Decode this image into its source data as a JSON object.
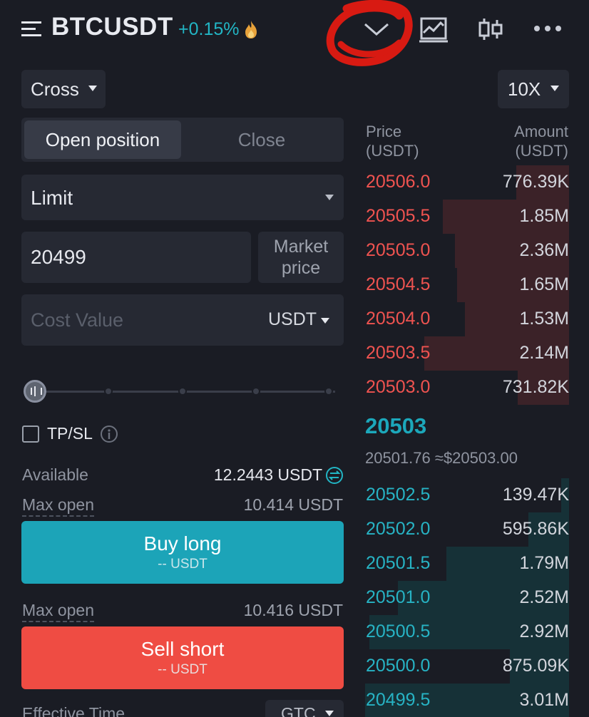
{
  "header": {
    "symbol": "BTCUSDT",
    "change": "+0.15%",
    "icons": [
      "menu-icon",
      "fire-icon",
      "chevron-down-icon",
      "chart-icon",
      "candlestick-icon",
      "more-icon"
    ]
  },
  "form": {
    "margin_mode": "Cross",
    "leverage": "10X",
    "tabs": {
      "open": "Open position",
      "close": "Close"
    },
    "order_type": "Limit",
    "price_value": "20499",
    "market_price_label": "Market price",
    "cost_placeholder": "Cost Value",
    "cost_unit": "USDT",
    "slider_percent": 0,
    "tpsl_label": "TP/SL",
    "available_label": "Available",
    "available_value": "12.2443 USDT",
    "buy": {
      "max_open_label": "Max open",
      "max_open_value": "10.414 USDT",
      "label": "Buy long",
      "sub": "-- USDT"
    },
    "sell": {
      "max_open_label": "Max open",
      "max_open_value": "10.416 USDT",
      "label": "Sell short",
      "sub": "-- USDT"
    },
    "effective_time_label": "Effective Time",
    "effective_time_value": "GTC"
  },
  "orderbook": {
    "price_header": "Price",
    "price_unit": "(USDT)",
    "amount_header": "Amount",
    "amount_unit": "(USDT)",
    "asks": [
      {
        "price": "20506.0",
        "amount": "776.39K",
        "depth": 0.26
      },
      {
        "price": "20505.5",
        "amount": "1.85M",
        "depth": 0.62
      },
      {
        "price": "20505.0",
        "amount": "2.36M",
        "depth": 0.56
      },
      {
        "price": "20504.5",
        "amount": "1.65M",
        "depth": 0.55
      },
      {
        "price": "20504.0",
        "amount": "1.53M",
        "depth": 0.51
      },
      {
        "price": "20503.5",
        "amount": "2.14M",
        "depth": 0.71
      },
      {
        "price": "20503.0",
        "amount": "731.82K",
        "depth": 0.25
      }
    ],
    "last_price": "20503",
    "mark_price": "20501.76 ≈$20503.00",
    "bids": [
      {
        "price": "20502.5",
        "amount": "139.47K",
        "depth": 0.04
      },
      {
        "price": "20502.0",
        "amount": "595.86K",
        "depth": 0.2
      },
      {
        "price": "20501.5",
        "amount": "1.79M",
        "depth": 0.6
      },
      {
        "price": "20501.0",
        "amount": "2.52M",
        "depth": 0.84
      },
      {
        "price": "20500.5",
        "amount": "2.92M",
        "depth": 0.98
      },
      {
        "price": "20500.0",
        "amount": "875.09K",
        "depth": 0.29
      },
      {
        "price": "20499.5",
        "amount": "3.01M",
        "depth": 1.0
      }
    ]
  },
  "colors": {
    "accent": "#1ca4b8",
    "sell": "#ef4c43",
    "ask_text": "#ef5350",
    "bid_text": "#27b3c4",
    "annotation": "#d81a12"
  }
}
